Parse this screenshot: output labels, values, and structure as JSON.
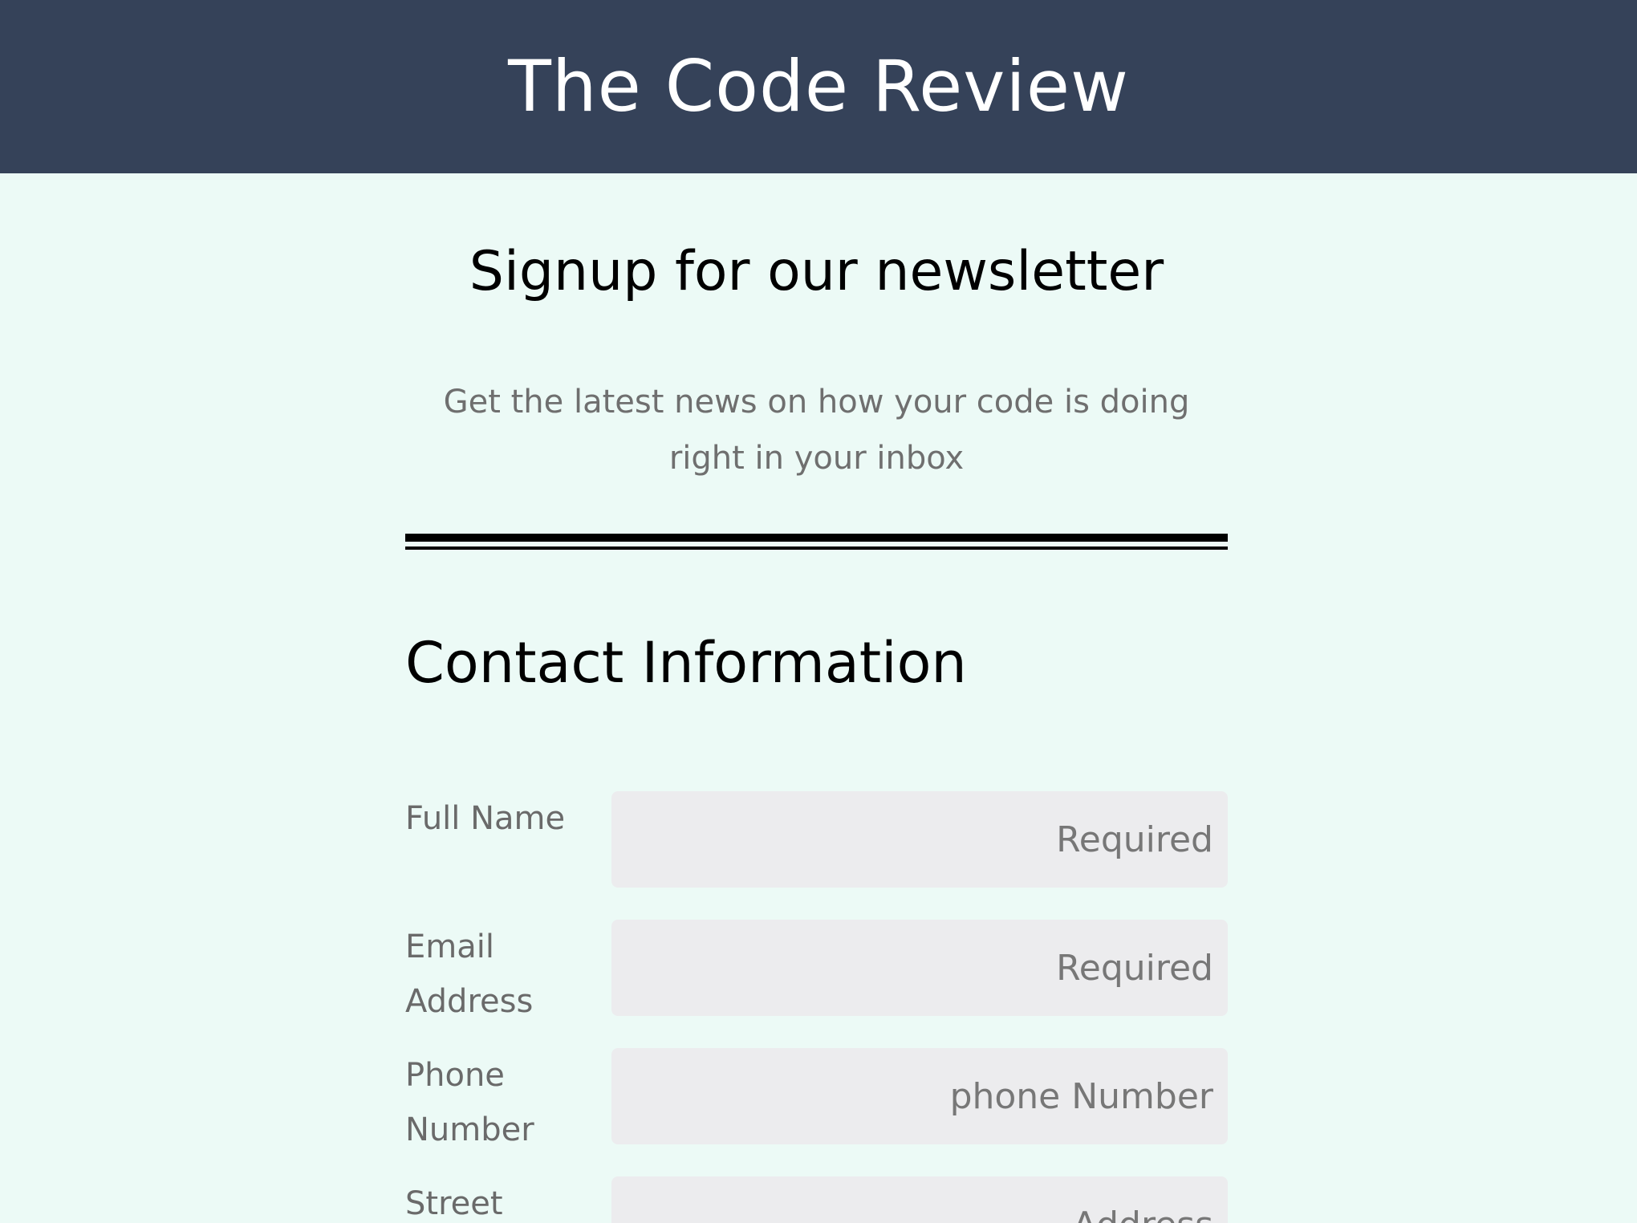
{
  "header": {
    "title": "The Code Review"
  },
  "signup": {
    "heading": "Signup for our newsletter",
    "subtext": "Get the latest news on how your code is doing right in your inbox"
  },
  "contact": {
    "heading": "Contact Information",
    "fields": [
      {
        "label": "Full Name",
        "placeholder": "Required",
        "value": ""
      },
      {
        "label": "Email Address",
        "placeholder": "Required",
        "value": ""
      },
      {
        "label": "Phone Number",
        "placeholder": "phone Number",
        "value": ""
      },
      {
        "label": "Street",
        "placeholder": "Address",
        "value": ""
      }
    ]
  },
  "colors": {
    "header_background": "#354259",
    "page_background": "#ecfaf6",
    "input_background": "#ececee",
    "label_text": "#6a6a6a"
  }
}
